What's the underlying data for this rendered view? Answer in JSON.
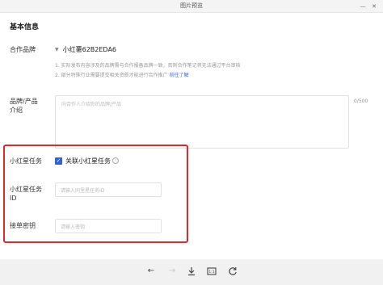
{
  "window": {
    "title": "图片预览"
  },
  "section": {
    "title": "基本信息"
  },
  "brand": {
    "label": "合作品牌",
    "icon": "shield-icon",
    "name": "小红薯62B2EDA6",
    "note1": "1. 实际发布内容涉及的品牌需与合作报备品牌一致，否则合作笔记将无法通过平台审核",
    "note2": "2. 部分特殊行业需要提交相关资质才能进行合作推广",
    "note2_link": "前往了解"
  },
  "product": {
    "label_line1": "品牌/产品",
    "label_line2": "介绍",
    "placeholder": "向合作人介绍你的品牌/产品",
    "counter": "0/500"
  },
  "task": {
    "label": "小红星任务",
    "checkbox_label": "关联小红星任务",
    "checked": true
  },
  "task_id": {
    "label_line1": "小红星任务",
    "label_line2": "ID",
    "placeholder": "请输入同里星任务ID"
  },
  "order_key": {
    "label": "接单密钥",
    "placeholder": "请输入密钥"
  },
  "highlight_color": "#e0282d",
  "accent_color": "#2f62d9",
  "toolbar": {
    "icons": [
      "arrow-left-icon",
      "arrow-right-icon",
      "download-icon",
      "actual-size-icon",
      "rotate-icon"
    ]
  }
}
